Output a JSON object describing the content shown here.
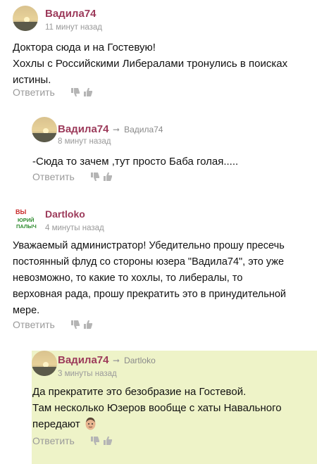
{
  "comments": [
    {
      "author": "Вадила74",
      "time": "11 минут назад",
      "lines": [
        "Доктора сюда и на Гостевую!",
        "Хохлы с Российскими Либералами тронулись в поисках",
        "истины."
      ],
      "reply_label": "Ответить"
    },
    {
      "author": "Вадила74",
      "reply_to": "Вадила74",
      "time": "8 минут назад",
      "lines": [
        "-Сюда то зачем ,тут просто Баба голая....."
      ],
      "reply_label": "Ответить"
    },
    {
      "author": "Dartloko",
      "avatar_text": "ЮРИЙ ПАЛЫЧ",
      "avatar_top": "ВЫ",
      "time": "4 минуты назад",
      "lines": [
        "Уважаемый администратор! Убедительно прошу пресечь",
        "постоянный флуд со стороны юзера \"Вадила74\", это уже",
        "невозможно, то какие то хохлы, то либералы, то",
        "верховная рада, прошу прекратить это в принудительной",
        "мере."
      ],
      "reply_label": "Ответить"
    },
    {
      "author": "Вадила74",
      "reply_to": "Dartloko",
      "time": "3 минуты назад",
      "lines": [
        "Да прекратите это безобразие на Гостевой.",
        "Там несколько Юзеров вообще с хаты Навального",
        "передают"
      ],
      "reply_label": "Ответить"
    }
  ],
  "icons": {
    "dislike": "thumb-down-icon",
    "like": "thumb-up-icon",
    "reply_arrow": "reply-arrow-icon"
  },
  "colors": {
    "author": "#9c3a5a",
    "highlight": "#eef3c8",
    "meta": "#9a9a9a"
  }
}
